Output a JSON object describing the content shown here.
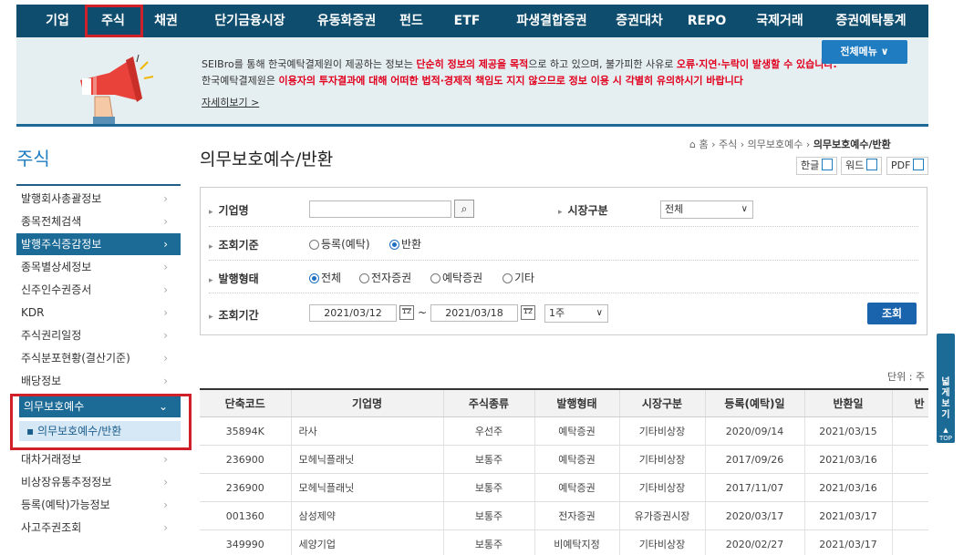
{
  "nav": {
    "items": [
      "기업",
      "주식",
      "채권",
      "단기금융시장",
      "유동화증권",
      "펀드",
      "ETF",
      "파생결합증권",
      "증권대차",
      "REPO",
      "국제거래",
      "증권예탁통계"
    ]
  },
  "banner": {
    "line1_a": "SEIBro를 통해 한국예탁결제원이 제공하는 정보는 ",
    "line1_b": "단순히 정보의 제공을 목적",
    "line1_c": "으로 하고 있으며, 불가피한 사유로 ",
    "line1_d": "오류·지연·누락이 발생할 수 있습니다.",
    "line2_a": "한국예탁결제원은 ",
    "line2_b": "이용자의 투자결과에 대해 어떠한 법적·경제적 책임도 지지 않으므로 정보 이용 시 각별히 유의하시기 바랍니다",
    "more": "자세히보기 >",
    "all_menu": "전체메뉴  ∨"
  },
  "left_menu": {
    "title": "주식",
    "items": [
      "발행회사총괄정보",
      "종목전체검색",
      "발행주식증감정보",
      "종목별상세정보",
      "신주인수권증서",
      "KDR",
      "주식권리일정",
      "주식분포현황(결산기준)",
      "배당정보",
      "의무보호예수",
      "대차거래정보",
      "비상장유통추정정보",
      "등록(예탁)가능정보",
      "사고주권조회"
    ],
    "sub_item": "의무보호예수/반환"
  },
  "page": {
    "title": "의무보호예수/반환",
    "breadcrumb": [
      "홈",
      "주식",
      "의무보호예수",
      "의무보호예수/반환"
    ],
    "downloads": [
      "한글",
      "워드",
      "PDF"
    ]
  },
  "search": {
    "company_label": "기업명",
    "company_value": "",
    "market_label": "시장구분",
    "market_value": "전체",
    "basis_label": "조회기준",
    "basis_options": [
      "등록(예탁)",
      "반환"
    ],
    "basis_selected": "반환",
    "issue_label": "발행형태",
    "issue_options": [
      "전체",
      "전자증권",
      "예탁증권",
      "기타"
    ],
    "issue_selected": "전체",
    "period_label": "조회기간",
    "date_from": "2021/03/12",
    "date_sep": "~",
    "date_to": "2021/03/18",
    "period_value": "1주",
    "search_button": "조회"
  },
  "unit_label": "단위 : 주",
  "table": {
    "headers": [
      "단축코드",
      "기업명",
      "주식종류",
      "발행형태",
      "시장구분",
      "등록(예탁)일",
      "반환일",
      "반"
    ],
    "rows": [
      [
        "35894K",
        "라사",
        "우선주",
        "예탁증권",
        "기타비상장",
        "2020/09/14",
        "2021/03/15",
        ""
      ],
      [
        "236900",
        "모헤닉플래닛",
        "보통주",
        "예탁증권",
        "기타비상장",
        "2017/09/26",
        "2021/03/16",
        ""
      ],
      [
        "236900",
        "모헤닉플래닛",
        "보통주",
        "예탁증권",
        "기타비상장",
        "2017/11/07",
        "2021/03/16",
        ""
      ],
      [
        "001360",
        "삼성제약",
        "보통주",
        "전자증권",
        "유가증권시장",
        "2020/03/17",
        "2021/03/17",
        ""
      ],
      [
        "349990",
        "세양기업",
        "보통주",
        "비예탁지정",
        "기타비상장",
        "2020/02/27",
        "2021/03/17",
        ""
      ]
    ]
  },
  "side_widget": {
    "label": "넓게보기",
    "top": "TOP"
  },
  "colors": {
    "nav_bg": "#0f4d6e",
    "accent": "#1f7cc0",
    "highlight_box": "#d0202a",
    "notice_red": "#e2001f"
  }
}
